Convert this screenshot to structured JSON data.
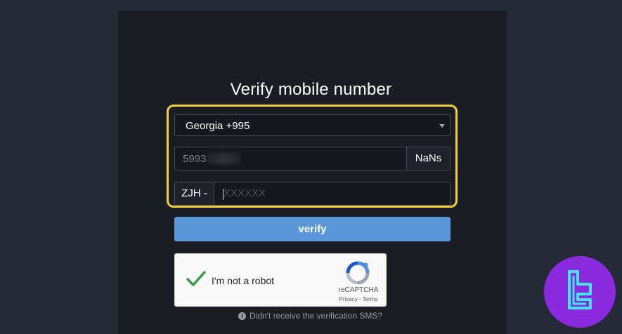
{
  "page": {
    "title": "Verify mobile number"
  },
  "form": {
    "country_select": {
      "value": "Georgia +995",
      "icon": "caret-down-icon"
    },
    "phone": {
      "value_visible": "5993",
      "suffix": "NaNs"
    },
    "code": {
      "prefix": "ZJH -",
      "placeholder": "XXXXXX"
    },
    "verify_label": "verify"
  },
  "captcha": {
    "label": "I'm not a robot",
    "brand": "reCAPTCHA",
    "links": "Privacy - Terms"
  },
  "help": {
    "text": "Didn't receive the verification SMS?"
  },
  "colors": {
    "page_bg": "#262a36",
    "panel_bg": "#1b1d25",
    "highlight": "#f3d03a",
    "button": "#5b97d8",
    "badge": "#8b2be0",
    "badge_glyph": "#3ee6f0"
  }
}
